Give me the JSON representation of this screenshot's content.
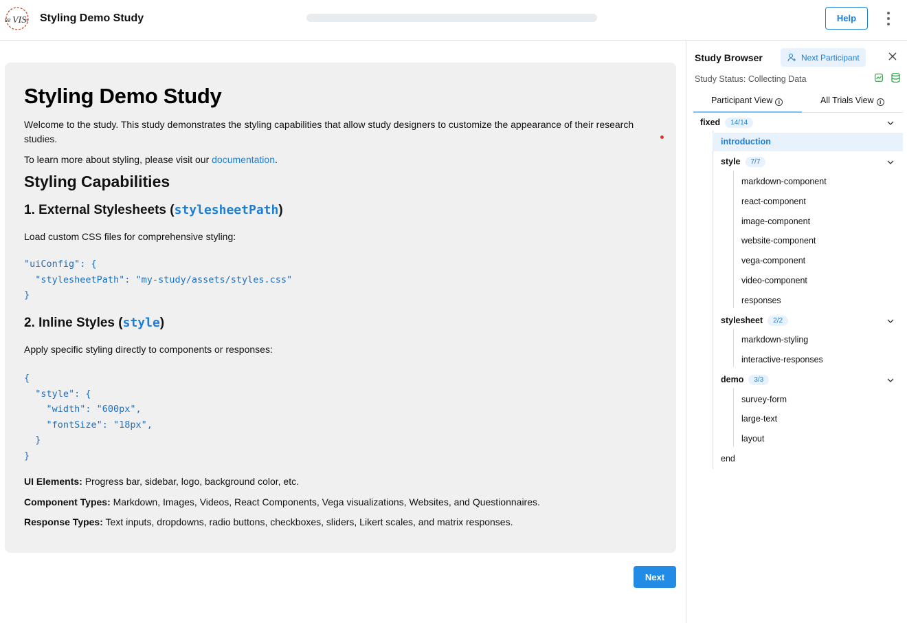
{
  "header": {
    "title": "Styling Demo Study",
    "help_label": "Help",
    "progress": 0.0
  },
  "main": {
    "title": "Styling Demo Study",
    "intro": "Welcome to the study. This study demonstrates the styling capabilities that allow study designers to customize the appearance of their research studies.",
    "learn_prefix": "To learn more about styling, please visit our ",
    "learn_link": "documentation",
    "learn_suffix": ".",
    "capabilities_heading": "Styling Capabilities",
    "section1": {
      "prefix": "1. External Stylesheets (",
      "code": "stylesheetPath",
      "suffix": ")",
      "desc": "Load custom CSS files for comprehensive styling:",
      "code_block": "\"uiConfig\": {\n  \"stylesheetPath\": \"my-study/assets/styles.css\"\n}"
    },
    "section2": {
      "prefix": "2. Inline Styles (",
      "code": "style",
      "suffix": ")",
      "desc": "Apply specific styling directly to components or responses:",
      "code_block": "{\n  \"style\": {\n    \"width\": \"600px\",\n    \"fontSize\": \"18px\",\n  }\n}"
    },
    "ui_elements": {
      "label": "UI Elements:",
      "text": " Progress bar, sidebar, logo, background color, etc."
    },
    "component_types": {
      "label": "Component Types:",
      "text": " Markdown, Images, Videos, React Components, Vega visualizations, Websites, and Questionnaires."
    },
    "response_types": {
      "label": "Response Types:",
      "text": " Text inputs, dropdowns, radio buttons, checkboxes, sliders, Likert scales, and matrix responses."
    },
    "next_label": "Next"
  },
  "sidebar": {
    "title": "Study Browser",
    "next_participant_label": "Next Participant",
    "status": "Study Status: Collecting Data",
    "tabs": [
      "Participant View",
      "All Trials View"
    ],
    "root": {
      "name": "fixed",
      "badge": "14/14"
    },
    "introduction": "introduction",
    "groups": [
      {
        "name": "style",
        "badge": "7/7",
        "items": [
          "markdown-component",
          "react-component",
          "image-component",
          "website-component",
          "vega-component",
          "video-component",
          "responses"
        ]
      },
      {
        "name": "stylesheet",
        "badge": "2/2",
        "items": [
          "markdown-styling",
          "interactive-responses"
        ]
      },
      {
        "name": "demo",
        "badge": "3/3",
        "items": [
          "survey-form",
          "large-text",
          "layout"
        ]
      }
    ],
    "end": "end"
  }
}
